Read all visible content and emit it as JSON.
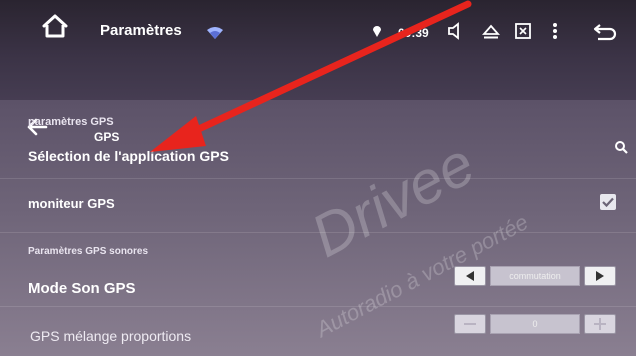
{
  "status_bar": {
    "app_title": "Paramètres",
    "time": "00:39"
  },
  "nav": {
    "page_title": "GPS"
  },
  "sections": [
    {
      "header": "paramètres GPS",
      "item": "Sélection de l'application GPS"
    },
    {
      "item": "moniteur GPS",
      "checked": true
    },
    {
      "header": "Paramètres GPS sonores",
      "item": "Mode Son GPS",
      "value": "commutation"
    },
    {
      "item": "GPS mélange proportions",
      "value": "0"
    }
  ],
  "watermark": {
    "line1": "Drivee",
    "line2": "Autoradio à votre portée"
  },
  "colors": {
    "annotation_arrow": "#e8241d",
    "checkbox_fill": "#e8e8ee"
  }
}
